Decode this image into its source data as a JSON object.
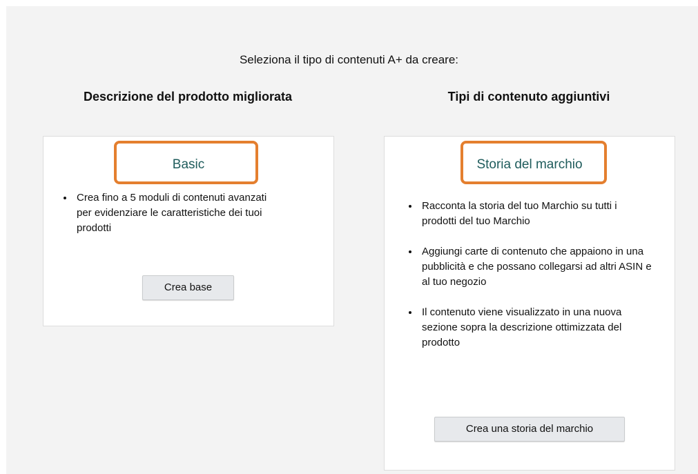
{
  "prompt": "Seleziona il tipo di contenuti A+ da creare:",
  "left_column": {
    "heading": "Descrizione del prodotto migliorata",
    "card": {
      "title": "Basic",
      "bullets": [
        "Crea fino a 5 moduli di contenuti avanzati per evidenziare le caratteristiche dei tuoi prodotti"
      ],
      "button_label": "Crea base"
    }
  },
  "right_column": {
    "heading": "Tipi di contenuto aggiuntivi",
    "card": {
      "title": "Storia del marchio",
      "bullets": [
        "Racconta la storia del tuo Marchio su tutti i prodotti del tuo Marchio",
        "Aggiungi carte di contenuto che appaiono in una pubblicità e che possano collegarsi ad altri ASIN e al tuo negozio",
        "Il contenuto viene visualizzato in una nuova sezione sopra la descrizione ottimizzata del prodotto"
      ],
      "button_label": "Crea una storia del marchio"
    }
  },
  "colors": {
    "page_background": "#f3f3f3",
    "card_title": "#1f5c5c",
    "highlight": "#e47f2f",
    "button_background": "#e7e9ec"
  }
}
